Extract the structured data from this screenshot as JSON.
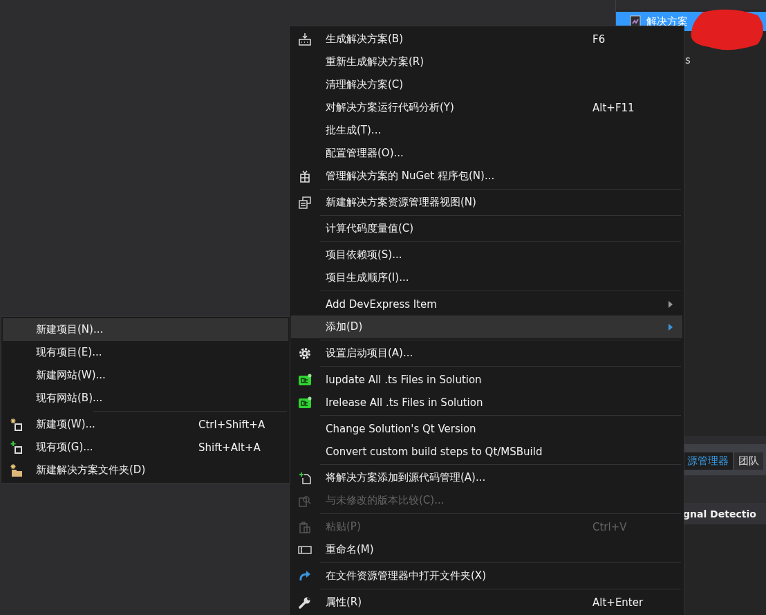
{
  "solution_explorer": {
    "selected_item": "解决方案",
    "line_2": "s"
  },
  "bottom_tabs": [
    {
      "label": "源管理器",
      "selected": true
    },
    {
      "label": "团队",
      "selected": false
    }
  ],
  "panel_title": "gnal Detectio",
  "context_menu": {
    "items": [
      {
        "kind": "build",
        "label": "生成解决方案(B)",
        "shortcut": "F6",
        "disabled": false,
        "selected": false,
        "submenu": false
      },
      {
        "kind": "item",
        "label": "重新生成解决方案(R)",
        "disabled": false,
        "selected": false,
        "submenu": false
      },
      {
        "kind": "item",
        "label": "清理解决方案(C)",
        "disabled": false,
        "selected": false,
        "submenu": false
      },
      {
        "kind": "item",
        "label": "对解决方案运行代码分析(Y)",
        "shortcut": "Alt+F11",
        "disabled": false,
        "selected": false,
        "submenu": false
      },
      {
        "kind": "item",
        "label": "批生成(T)...",
        "disabled": false,
        "selected": false,
        "submenu": false
      },
      {
        "kind": "item",
        "label": "配置管理器(O)...",
        "disabled": false,
        "selected": false,
        "submenu": false
      },
      {
        "kind": "package",
        "label": "管理解决方案的 NuGet 程序包(N)...",
        "disabled": false,
        "selected": false,
        "submenu": false
      },
      {
        "kind": "separator"
      },
      {
        "kind": "windows",
        "label": "新建解决方案资源管理器视图(N)",
        "disabled": false,
        "selected": false,
        "submenu": false
      },
      {
        "kind": "separator"
      },
      {
        "kind": "item",
        "label": "计算代码度量值(C)",
        "disabled": false,
        "selected": false,
        "submenu": false
      },
      {
        "kind": "separator"
      },
      {
        "kind": "item",
        "label": "项目依赖项(S)...",
        "disabled": false,
        "selected": false,
        "submenu": false
      },
      {
        "kind": "item",
        "label": "项目生成顺序(I)...",
        "disabled": false,
        "selected": false,
        "submenu": false
      },
      {
        "kind": "separator"
      },
      {
        "kind": "item",
        "label": "Add DevExpress Item",
        "disabled": false,
        "selected": false,
        "submenu": true
      },
      {
        "kind": "item",
        "label": "添加(D)",
        "disabled": false,
        "selected": true,
        "submenu": true
      },
      {
        "kind": "separator"
      },
      {
        "kind": "gear",
        "label": "设置启动项目(A)...",
        "disabled": false,
        "selected": false,
        "submenu": false
      },
      {
        "kind": "separator"
      },
      {
        "kind": "qt",
        "label": "lupdate All .ts Files in Solution",
        "disabled": false,
        "selected": false,
        "submenu": false
      },
      {
        "kind": "qt",
        "label": "lrelease All .ts Files in Solution",
        "disabled": false,
        "selected": false,
        "submenu": false
      },
      {
        "kind": "separator"
      },
      {
        "kind": "item",
        "label": "Change Solution's Qt Version",
        "disabled": false,
        "selected": false,
        "submenu": false
      },
      {
        "kind": "item",
        "label": "Convert custom build steps to Qt/MSBuild",
        "disabled": false,
        "selected": false,
        "submenu": false
      },
      {
        "kind": "separator"
      },
      {
        "kind": "add-file",
        "label": "将解决方案添加到源代码管理(A)...",
        "disabled": false,
        "selected": false,
        "submenu": false
      },
      {
        "kind": "compare",
        "label": "与未修改的版本比较(C)...",
        "disabled": true,
        "selected": false,
        "submenu": false
      },
      {
        "kind": "separator"
      },
      {
        "kind": "paste",
        "label": "粘贴(P)",
        "shortcut": "Ctrl+V",
        "disabled": true,
        "selected": false,
        "submenu": false
      },
      {
        "kind": "rename",
        "label": "重命名(M)",
        "disabled": false,
        "selected": false,
        "submenu": false
      },
      {
        "kind": "separator"
      },
      {
        "kind": "redo",
        "label": "在文件资源管理器中打开文件夹(X)",
        "disabled": false,
        "selected": false,
        "submenu": false
      },
      {
        "kind": "separator"
      },
      {
        "kind": "wrench",
        "label": "属性(R)",
        "shortcut": "Alt+Enter",
        "disabled": false,
        "selected": false,
        "submenu": false
      }
    ]
  },
  "submenu": {
    "items": [
      {
        "kind": "item",
        "label": "新建项目(N)...",
        "disabled": false,
        "selected": true,
        "submenu": false
      },
      {
        "kind": "item",
        "label": "现有项目(E)...",
        "disabled": false,
        "selected": false,
        "submenu": false
      },
      {
        "kind": "item",
        "label": "新建网站(W)...",
        "disabled": false,
        "selected": false,
        "submenu": false
      },
      {
        "kind": "item",
        "label": "现有网站(B)...",
        "disabled": false,
        "selected": false,
        "submenu": false
      },
      {
        "kind": "separator"
      },
      {
        "kind": "new-item",
        "label": "新建项(W)...",
        "shortcut": "Ctrl+Shift+A",
        "disabled": false,
        "selected": false,
        "submenu": false
      },
      {
        "kind": "existing-item",
        "label": "现有项(G)...",
        "shortcut": "Shift+Alt+A",
        "disabled": false,
        "selected": false,
        "submenu": false
      },
      {
        "kind": "folder",
        "label": "新建解决方案文件夹(D)",
        "disabled": false,
        "selected": false,
        "submenu": false
      }
    ]
  }
}
